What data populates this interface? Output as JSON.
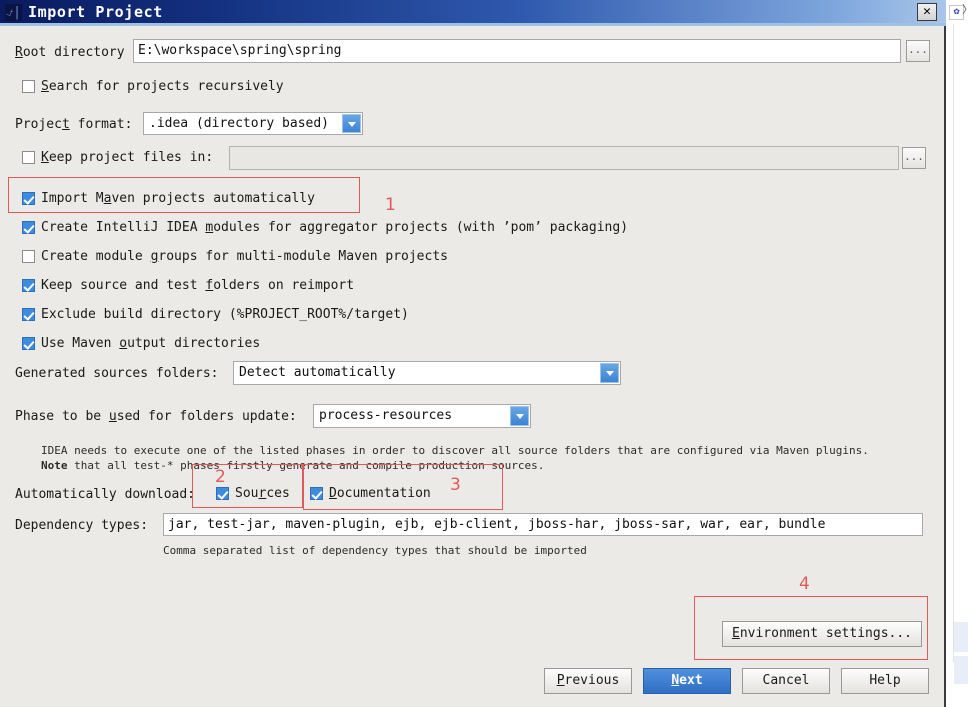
{
  "window": {
    "title": "Import Project",
    "icon": "idea-logo-icon",
    "close_label": "✕"
  },
  "form": {
    "root_directory": {
      "label_pre": "R",
      "label_post": "oot directory",
      "value": "E:\\workspace\\spring\\spring",
      "browse_label": "..."
    },
    "search_recursively": {
      "label_pre": "S",
      "label_post": "earch for projects recursively",
      "checked": false
    },
    "project_format": {
      "label_a": "Projec",
      "label_b": "t",
      "label_c": " format:",
      "value": ".idea (directory based)"
    },
    "keep_project_files_in": {
      "label_pre": "K",
      "label_post": "eep project files in:",
      "checked": false,
      "value": "",
      "browse_label": "..."
    },
    "checkboxes": [
      {
        "id": "import-maven-projects-automatically",
        "pre": "Import M",
        "mnem": "a",
        "post": "ven projects automatically",
        "checked": true
      },
      {
        "id": "create-intellij-idea-modules",
        "pre": "Create IntelliJ IDEA ",
        "mnem": "m",
        "post": "odules for aggregator projects (with ’pom’ packaging)",
        "checked": true
      },
      {
        "id": "create-module-groups",
        "pre": "Create module ",
        "mnem": "g",
        "post": "roups for multi-module Maven projects",
        "checked": false
      },
      {
        "id": "keep-source-and-test-folders",
        "pre": "Keep source and test ",
        "mnem": "f",
        "post": "olders on reimport",
        "checked": true
      },
      {
        "id": "exclude-build-directory",
        "pre": "Exclude build directory (%PROJECT_ROOT%/target)",
        "mnem": "",
        "post": "",
        "checked": true
      },
      {
        "id": "use-maven-output-directories",
        "pre": "Use Maven ",
        "mnem": "o",
        "post": "utput directories",
        "checked": true
      }
    ],
    "generated_sources": {
      "label": "Generated sources folders:",
      "value": "Detect automatically"
    },
    "phase": {
      "label_a": "Phase to be ",
      "label_b": "u",
      "label_c": "sed for folders update:",
      "value": "process-resources"
    },
    "note_line1": "IDEA needs to execute one of the listed phases in order to discover all source folders that are configured via Maven plugins.",
    "note_line2_bold": "Note",
    "note_line2_rest": " that all test-* phases firstly generate and compile production sources.",
    "auto_download": {
      "label": "Automatically download:",
      "sources": {
        "pre": "Sou",
        "mnem": "r",
        "post": "ces",
        "checked": true
      },
      "documentation": {
        "pre": "",
        "mnem": "D",
        "post": "ocumentation",
        "checked": true
      }
    },
    "dependency_types": {
      "label": "Dependency types:",
      "value": "jar, test-jar, maven-plugin, ejb, ejb-client, jboss-har, jboss-sar, war, ear, bundle",
      "hint": "Comma separated list of dependency types that should be imported"
    },
    "environment_settings": {
      "pre": "E",
      "post": "nvironment settings..."
    }
  },
  "buttons": {
    "previous": {
      "pre": "P",
      "post": "revious"
    },
    "next": {
      "pre": "N",
      "post": "ext"
    },
    "cancel": {
      "label": "Cancel"
    },
    "help": {
      "label": "Help"
    }
  },
  "annotations": {
    "n1": "1",
    "n2": "2",
    "n3": "3",
    "n4": "4",
    "color": "#e05a5a"
  },
  "desktop": {
    "icon_glyph": "✿",
    "chevron": "〉"
  }
}
